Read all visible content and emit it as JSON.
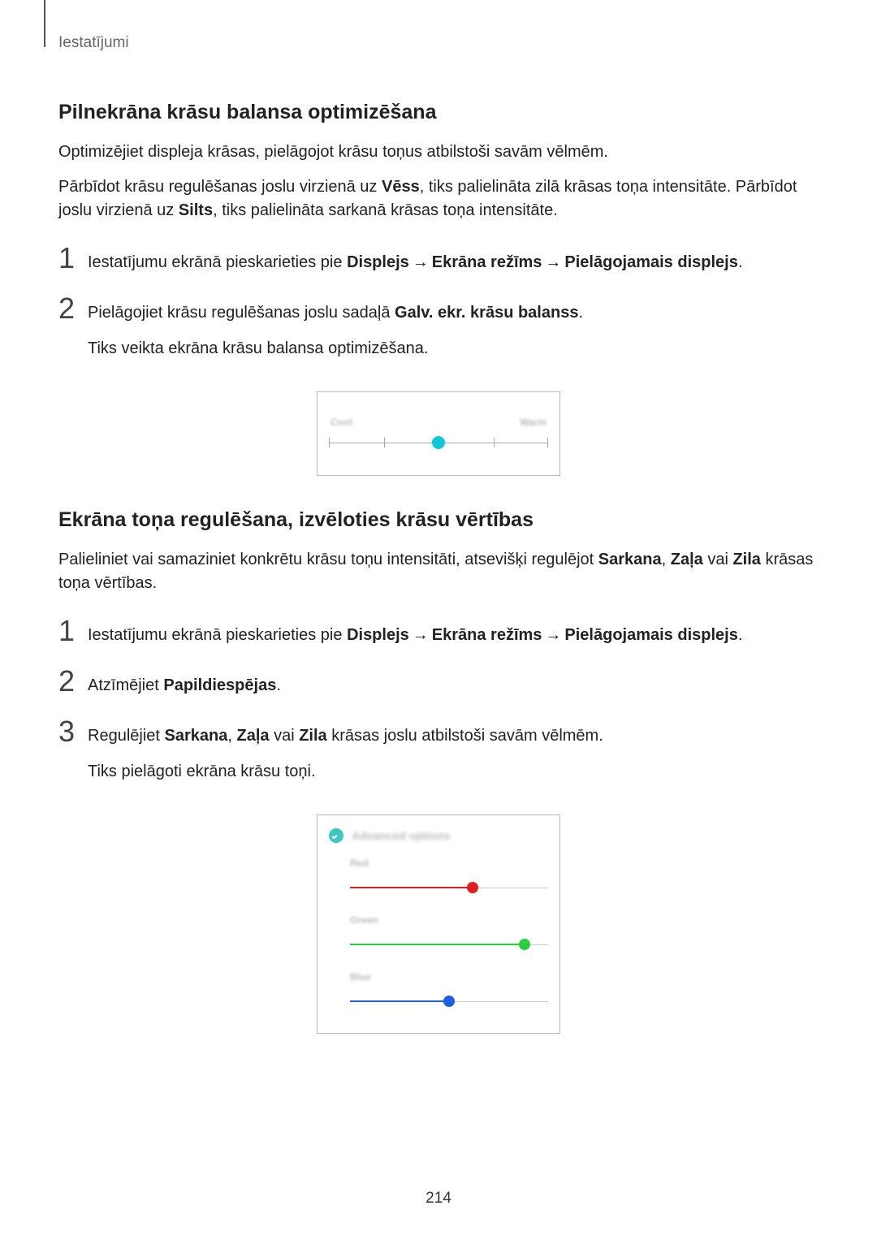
{
  "header": {
    "label": "Iestatījumi"
  },
  "section1": {
    "heading": "Pilnekrāna krāsu balansa optimizēšana",
    "intro": "Optimizējiet displeja krāsas, pielāgojot krāsu toņus atbilstoši savām vēlmēm.",
    "para2_a": "Pārbīdot krāsu regulēšanas joslu virzienā uz ",
    "para2_b": "Vēss",
    "para2_c": ", tiks palielināta zilā krāsas toņa intensitāte. Pārbīdot joslu virzienā uz ",
    "para2_d": "Silts",
    "para2_e": ", tiks palielināta sarkanā krāsas toņa intensitāte.",
    "steps": {
      "n1": "1",
      "s1_a": "Iestatījumu ekrānā pieskarieties pie ",
      "s1_b": "Displejs",
      "s1_c": "Ekrāna režīms",
      "s1_d": "Pielāgojamais displejs",
      "n2": "2",
      "s2_a": "Pielāgojiet krāsu regulēšanas joslu sadaļā ",
      "s2_b": "Galv. ekr. krāsu balanss",
      "s2_c": ".",
      "s2_sub": "Tiks veikta ekrāna krāsu balansa optimizēšana."
    },
    "figure": {
      "left_label": "Cool",
      "right_label": "Warm"
    }
  },
  "section2": {
    "heading": "Ekrāna toņa regulēšana, izvēloties krāsu vērtības",
    "intro_a": "Palieliniet vai samaziniet konkrētu krāsu toņu intensitāti, atsevišķi regulējot ",
    "intro_r": "Sarkana",
    "intro_sep1": ", ",
    "intro_g": "Zaļa",
    "intro_sep2": " vai ",
    "intro_b": "Zila",
    "intro_end": " krāsas toņa vērtības.",
    "steps": {
      "n1": "1",
      "s1_a": "Iestatījumu ekrānā pieskarieties pie ",
      "s1_b": "Displejs",
      "s1_c": "Ekrāna režīms",
      "s1_d": "Pielāgojamais displejs",
      "n2": "2",
      "s2_a": "Atzīmējiet ",
      "s2_b": "Papildiespējas",
      "s2_c": ".",
      "n3": "3",
      "s3_a": "Regulējiet ",
      "s3_r": "Sarkana",
      "s3_sep1": ", ",
      "s3_g": "Zaļa",
      "s3_sep2": " vai ",
      "s3_b": "Zila",
      "s3_end": " krāsas joslu atbilstoši savām vēlmēm.",
      "s3_sub": "Tiks pielāgoti ekrāna krāsu toņi."
    },
    "figure": {
      "adv_label": "Advanced options",
      "red_label": "Red",
      "green_label": "Green",
      "blue_label": "Blue"
    }
  },
  "page_number": "214",
  "chart_data": {
    "type": "slider-set",
    "sliders": [
      {
        "name": "color-balance",
        "min": 0,
        "max": 4,
        "value": 2,
        "left": "Cool",
        "right": "Warm"
      },
      {
        "name": "red",
        "min": 0,
        "max": 100,
        "value": 62,
        "color": "#e02020"
      },
      {
        "name": "green",
        "min": 0,
        "max": 100,
        "value": 88,
        "color": "#2ecc40"
      },
      {
        "name": "blue",
        "min": 0,
        "max": 100,
        "value": 50,
        "color": "#1f5fe0"
      }
    ]
  }
}
